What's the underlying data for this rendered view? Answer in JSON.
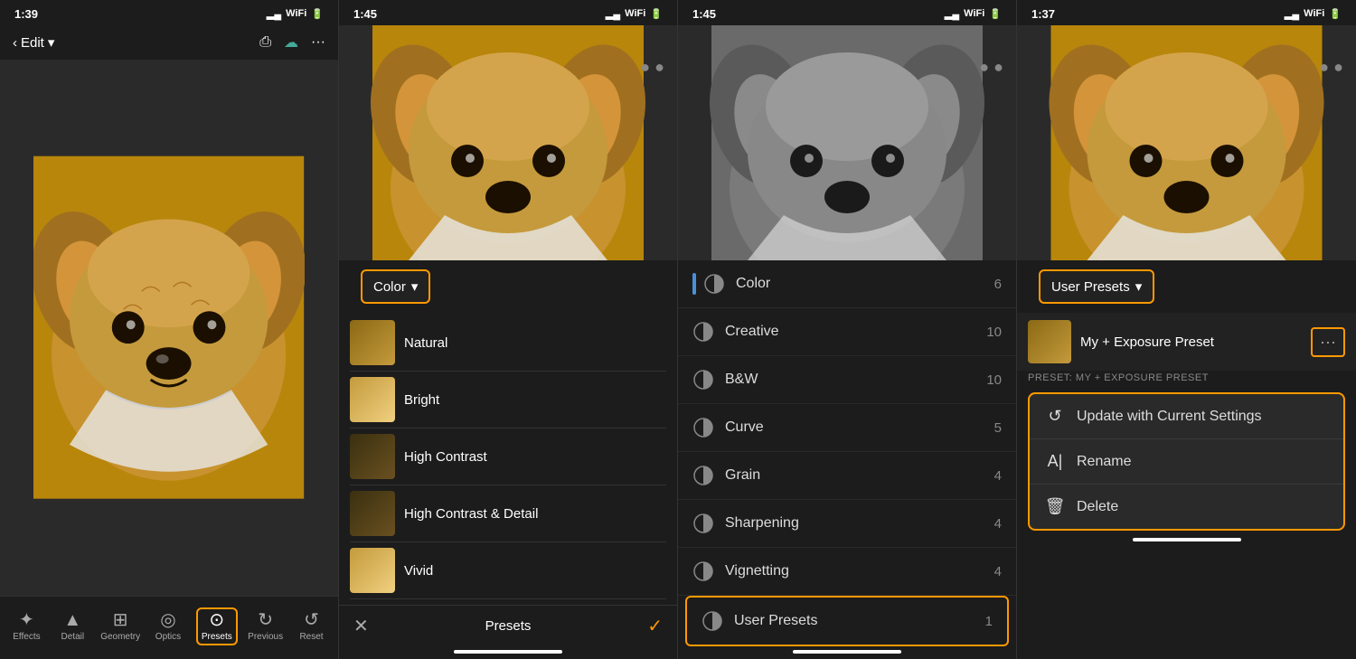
{
  "panels": [
    {
      "id": "panel1",
      "status": {
        "time": "1:39",
        "icons": "▂▄ ᵀ 🔋"
      },
      "nav": {
        "back": "‹",
        "edit": "Edit",
        "chevron": "▾"
      },
      "tools": [
        {
          "name": "Effects",
          "icon": "✦",
          "id": "effects"
        },
        {
          "name": "Detail",
          "icon": "▲",
          "id": "detail"
        },
        {
          "name": "Geometry",
          "icon": "⊞",
          "id": "geometry"
        },
        {
          "name": "Optics",
          "icon": "◎",
          "id": "optics"
        },
        {
          "name": "Presets",
          "icon": "⊙",
          "id": "presets",
          "active": true
        },
        {
          "name": "Previous",
          "icon": "↻",
          "id": "previous"
        },
        {
          "name": "Reset",
          "icon": "↺",
          "id": "reset"
        }
      ]
    },
    {
      "id": "panel2",
      "status": {
        "time": "1:45"
      },
      "dropdown_label": "Color",
      "presets": [
        {
          "name": "Natural",
          "style": "normal"
        },
        {
          "name": "Bright",
          "style": "bright"
        },
        {
          "name": "High Contrast",
          "style": "dark"
        },
        {
          "name": "High Contrast & Detail",
          "style": "dark"
        },
        {
          "name": "Vivid",
          "style": "bright"
        }
      ],
      "footer": {
        "cancel": "✕",
        "label": "Presets",
        "check": "✓"
      }
    },
    {
      "id": "panel3",
      "status": {
        "time": "1:45"
      },
      "categories": [
        {
          "name": "Color",
          "count": 6,
          "icon": "◑"
        },
        {
          "name": "Creative",
          "count": 10,
          "icon": "◑"
        },
        {
          "name": "B&W",
          "count": 10,
          "icon": "◑"
        },
        {
          "name": "Curve",
          "count": 5,
          "icon": "◑"
        },
        {
          "name": "Grain",
          "count": 4,
          "icon": "◑"
        },
        {
          "name": "Sharpening",
          "count": 4,
          "icon": "◑"
        },
        {
          "name": "Vignetting",
          "count": 4,
          "icon": "◑"
        },
        {
          "name": "User Presets",
          "count": 1,
          "icon": "◑",
          "highlighted": true
        }
      ]
    },
    {
      "id": "panel4",
      "status": {
        "time": "1:37"
      },
      "dropdown_label": "User Presets",
      "preset": {
        "name": "My + Exposure Preset",
        "label": "PRESET: MY + EXPOSURE PRESET"
      },
      "context_menu": [
        {
          "icon": "↺",
          "label": "Update with Current Settings"
        },
        {
          "icon": "A|",
          "label": "Rename"
        },
        {
          "icon": "🗑",
          "label": "Delete"
        }
      ]
    }
  ]
}
